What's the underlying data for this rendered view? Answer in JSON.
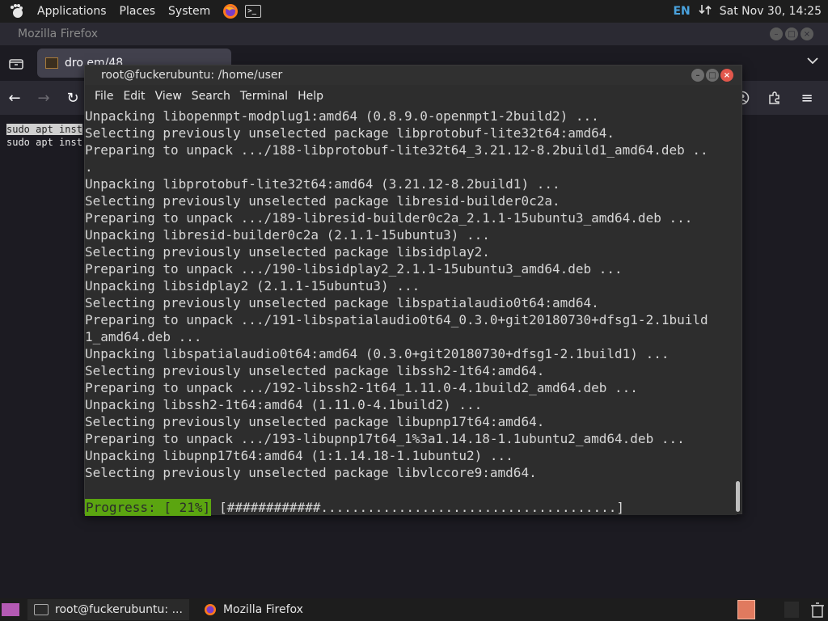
{
  "top_panel": {
    "menus": [
      "Applications",
      "Places",
      "System"
    ],
    "keyboard_layout": "EN",
    "clock": "Sat Nov 30, 14:25"
  },
  "firefox": {
    "window_title": "Mozilla Firefox",
    "tab_title": "dro em/48",
    "page_lines": [
      "sudo apt inst",
      "sudo apt inst"
    ]
  },
  "terminal": {
    "title": "root@fuckerubuntu: /home/user",
    "menu": [
      "File",
      "Edit",
      "View",
      "Search",
      "Terminal",
      "Help"
    ],
    "lines": [
      "Unpacking libopenmpt-modplug1:amd64 (0.8.9.0-openmpt1-2build2) ...",
      "Selecting previously unselected package libprotobuf-lite32t64:amd64.",
      "Preparing to unpack .../188-libprotobuf-lite32t64_3.21.12-8.2build1_amd64.deb ..",
      ".",
      "Unpacking libprotobuf-lite32t64:amd64 (3.21.12-8.2build1) ...",
      "Selecting previously unselected package libresid-builder0c2a.",
      "Preparing to unpack .../189-libresid-builder0c2a_2.1.1-15ubuntu3_amd64.deb ...",
      "Unpacking libresid-builder0c2a (2.1.1-15ubuntu3) ...",
      "Selecting previously unselected package libsidplay2.",
      "Preparing to unpack .../190-libsidplay2_2.1.1-15ubuntu3_amd64.deb ...",
      "Unpacking libsidplay2 (2.1.1-15ubuntu3) ...",
      "Selecting previously unselected package libspatialaudio0t64:amd64.",
      "Preparing to unpack .../191-libspatialaudio0t64_0.3.0+git20180730+dfsg1-2.1build",
      "1_amd64.deb ...",
      "Unpacking libspatialaudio0t64:amd64 (0.3.0+git20180730+dfsg1-2.1build1) ...",
      "Selecting previously unselected package libssh2-1t64:amd64.",
      "Preparing to unpack .../192-libssh2-1t64_1.11.0-4.1build2_amd64.deb ...",
      "Unpacking libssh2-1t64:amd64 (1.11.0-4.1build2) ...",
      "Selecting previously unselected package libupnp17t64:amd64.",
      "Preparing to unpack .../193-libupnp17t64_1%3a1.14.18-1.1ubuntu2_amd64.deb ...",
      "Unpacking libupnp17t64:amd64 (1:1.14.18-1.1ubuntu2) ...",
      "Selecting previously unselected package libvlccore9:amd64."
    ],
    "progress_label": "Progress: [ 21%]",
    "progress_bar": "[############......................................]",
    "progress_percent": 21
  },
  "taskbar": {
    "tasks": [
      "root@fuckerubuntu: ...",
      "Mozilla Firefox"
    ]
  },
  "colors": {
    "progress_green": "#5ba510",
    "close_red": "#e2574c",
    "keyboard_blue": "#4aa3df"
  }
}
